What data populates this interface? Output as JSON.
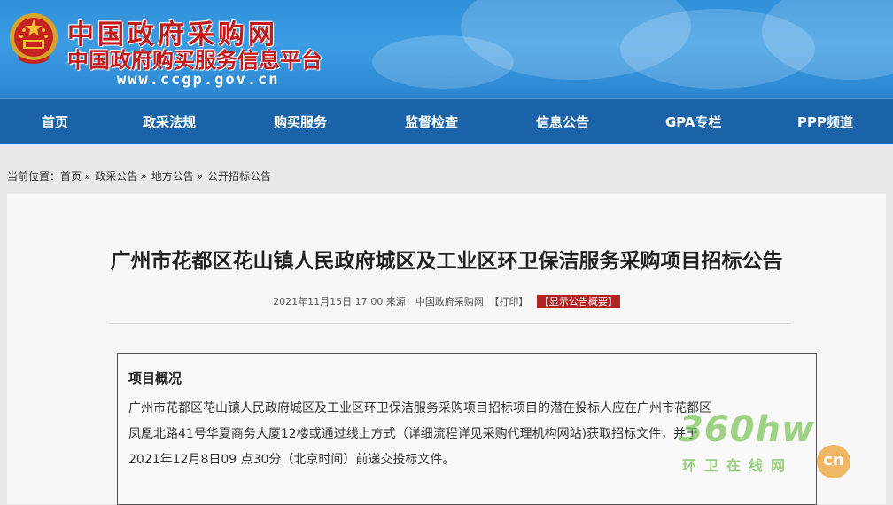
{
  "header": {
    "site_title": "中国政府采购网",
    "site_subtitle": "中国政府购买服务信息平台",
    "site_url": "www.ccgp.gov.cn"
  },
  "nav": {
    "items": [
      {
        "label": "首页"
      },
      {
        "label": "政采法规"
      },
      {
        "label": "购买服务"
      },
      {
        "label": "监督检查"
      },
      {
        "label": "信息公告"
      },
      {
        "label": "GPA专栏"
      },
      {
        "label": "PPP频道"
      }
    ]
  },
  "breadcrumb": {
    "prefix": "当前位置：",
    "items": [
      {
        "label": "首页"
      },
      {
        "label": "政采公告"
      },
      {
        "label": "地方公告"
      },
      {
        "label": "公开招标公告"
      }
    ],
    "separator": "»"
  },
  "article": {
    "title": "广州市花都区花山镇人民政府城区及工业区环卫保洁服务采购项目招标公告",
    "meta_date": "2021年11月15日 17:00 来源：中国政府采购网",
    "print_label": "【打印】",
    "summary_label": "【显示公告概要】",
    "section_heading": "项目概况",
    "lines": [
      "广州市花都区花山镇人民政府城区及工业区环卫保洁服务采购项目招标项目的潜在投标人应在广州市花都区",
      "凤凰北路41号华夏商务大厦12楼或通过线上方式（详细流程详见采购代理机构网站)获取招标文件，并于",
      "2021年12月8日09 点30分（北京时间）前递交投标文件。"
    ]
  },
  "watermark": {
    "main": "360hw",
    "sub": "环卫在线网",
    "badge": "cn"
  },
  "colors": {
    "header_blue": "#2f8fd8",
    "nav_blue": "#1a63a8",
    "title_red": "#c21a1a",
    "summary_red": "#b52222"
  }
}
